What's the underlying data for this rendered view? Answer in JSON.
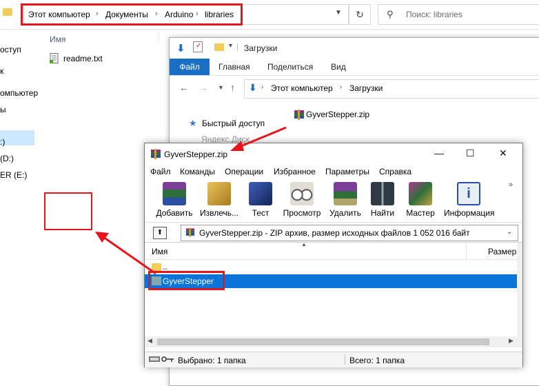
{
  "background_explorer": {
    "breadcrumbs": [
      "Этот компьютер",
      "Документы",
      "Arduino",
      "libraries"
    ],
    "search_placeholder": "Поиск: libraries",
    "sidebar_items": [
      "оступ",
      "к",
      "омпьютер",
      "ы",
      ":)",
      "(D:)",
      "ER (E:)"
    ],
    "column_name": "Имя",
    "files": [
      "readme.txt"
    ]
  },
  "downloads_window": {
    "title": "Загрузки",
    "ribbon_tabs": [
      "Файл",
      "Главная",
      "Поделиться",
      "Вид"
    ],
    "breadcrumbs": [
      "Этот компьютер",
      "Загрузки"
    ],
    "quick_access": "Быстрый доступ",
    "faded_item": "Яндекс.Диск",
    "zip_file": "GyverStepper.zip"
  },
  "winrar_window": {
    "title": "GyverStepper.zip",
    "menu": [
      "Файл",
      "Команды",
      "Операции",
      "Избранное",
      "Параметры",
      "Справка"
    ],
    "toolbar": [
      {
        "label": "Добавить",
        "icon": "add-icon",
        "color": "#7b3f98"
      },
      {
        "label": "Извлечь...",
        "icon": "extract-icon",
        "color": "#c99a2e"
      },
      {
        "label": "Тест",
        "icon": "test-icon",
        "color": "#1f3a8c"
      },
      {
        "label": "Просмотр",
        "icon": "view-icon",
        "color": "#8a8a8a"
      },
      {
        "label": "Удалить",
        "icon": "delete-icon",
        "color": "#6f4aa0"
      },
      {
        "label": "Найти",
        "icon": "find-icon",
        "color": "#4a5560"
      },
      {
        "label": "Мастер",
        "icon": "wizard-icon",
        "color": "#7b2f8f"
      },
      {
        "label": "Информация",
        "icon": "info-icon",
        "color": "#3a6ea5"
      }
    ],
    "path_text": "GyverStepper.zip - ZIP архив, размер исходных файлов 1 052 016 байт",
    "columns": [
      "Имя",
      "Размер"
    ],
    "rows": [
      ".. ",
      "GyverStepper"
    ],
    "status_left": "Выбрано: 1 папка",
    "status_right": "Всего: 1 папка"
  },
  "colors": {
    "annotation_red": "#e8141b",
    "selection_blue": "#0a74d8",
    "ribbon_blue": "#1a6fc4"
  }
}
